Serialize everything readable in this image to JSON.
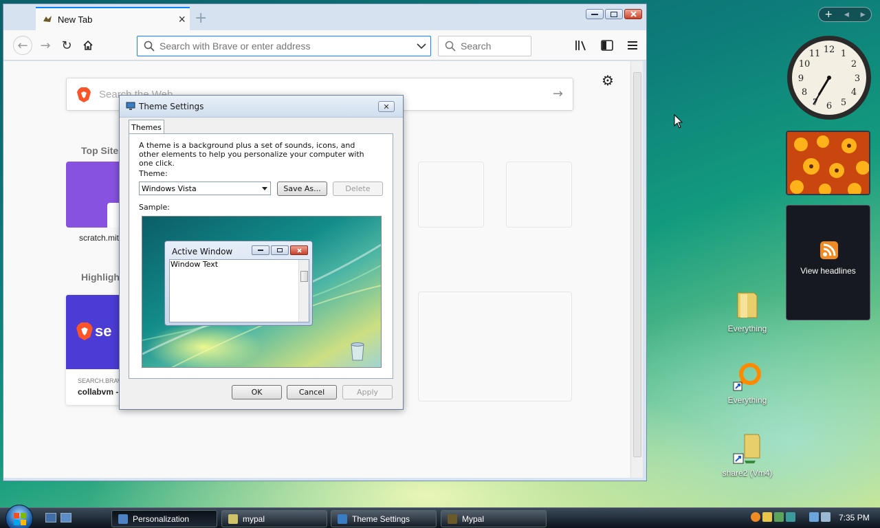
{
  "browser": {
    "tab_title": "New Tab",
    "url_placeholder": "Search with Brave or enter address",
    "search_placeholder": "Search",
    "websearch_placeholder": "Search the Web",
    "top_sites_title": "Top Sites",
    "top_site_label": "scratch.mit",
    "highlights_title": "Highlights",
    "highlight_source": "SEARCH.BRAV",
    "highlight_title": "collabvm -",
    "highlight_logo_text": "se"
  },
  "dialog": {
    "title": "Theme Settings",
    "close_label": "✕",
    "tab_label": "Themes",
    "description": "A theme is a background plus a set of sounds, icons, and other elements to help you personalize your computer with one click.",
    "theme_label": "Theme:",
    "theme_value": "Windows Vista",
    "save_as_label": "Save As...",
    "delete_label": "Delete",
    "sample_label": "Sample:",
    "sample_window_title": "Active Window",
    "sample_window_text": "Window Text",
    "ok_label": "OK",
    "cancel_label": "Cancel",
    "apply_label": "Apply"
  },
  "desktop": {
    "icons": [
      {
        "label": "Everything"
      },
      {
        "label": "Everything"
      },
      {
        "label": "share2 (Vm4)"
      }
    ],
    "feed_label": "View headlines",
    "clock_time": "7:35"
  },
  "taskbar": {
    "tasks": [
      {
        "label": "Personalization"
      },
      {
        "label": "mypal"
      },
      {
        "label": "Theme Settings"
      },
      {
        "label": "Mypal"
      }
    ],
    "time": "7:35 PM"
  },
  "colors": {
    "accent": "#0a84ff",
    "top_site_tile": "#8852e0",
    "highlight_image": "#4c3cd6",
    "brave_orange": "#fb542b"
  }
}
